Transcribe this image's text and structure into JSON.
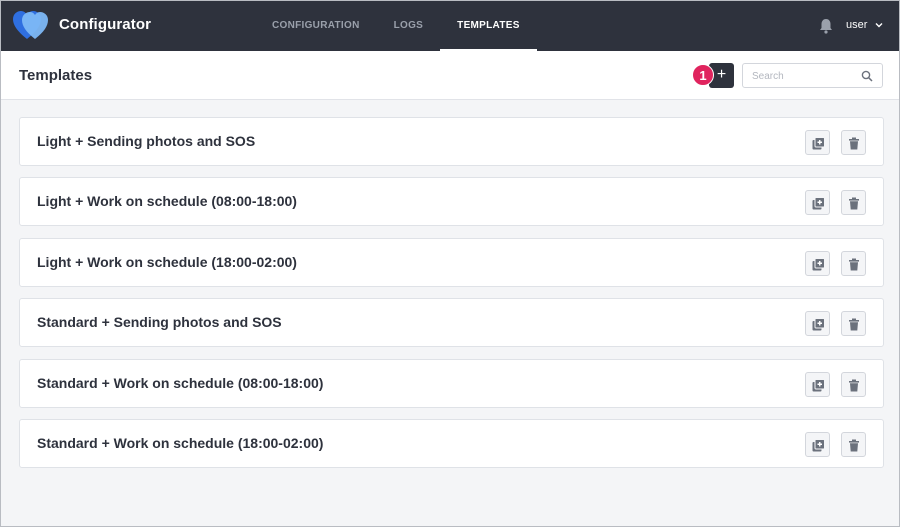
{
  "app": {
    "title": "Configurator",
    "logo_icon": "heart-logo-icon",
    "colors": {
      "topbar": "#2e323d",
      "logo_primary": "#2f6fe0",
      "logo_secondary": "#7db8f5",
      "badge": "#e0245e"
    }
  },
  "nav": {
    "tabs": [
      {
        "label": "CONFIGURATION",
        "active": false
      },
      {
        "label": "LOGS",
        "active": false
      },
      {
        "label": "TEMPLATES",
        "active": true
      }
    ]
  },
  "user": {
    "name": "user",
    "bell_icon": "bell-icon",
    "chevron_icon": "chevron-down-icon"
  },
  "header": {
    "title": "Templates",
    "add_label": "+",
    "badge": "1",
    "search_placeholder": "Search",
    "search_icon": "search-icon"
  },
  "templates": [
    {
      "name": "Light + Sending photos and SOS"
    },
    {
      "name": "Light + Work on schedule (08:00-18:00)"
    },
    {
      "name": "Light + Work on schedule (18:00-02:00)"
    },
    {
      "name": "Standard + Sending photos and SOS"
    },
    {
      "name": "Standard + Work on schedule (08:00-18:00)"
    },
    {
      "name": "Standard + Work on schedule (18:00-02:00)"
    }
  ],
  "row_actions": {
    "copy_icon": "copy-icon",
    "delete_icon": "trash-icon"
  }
}
